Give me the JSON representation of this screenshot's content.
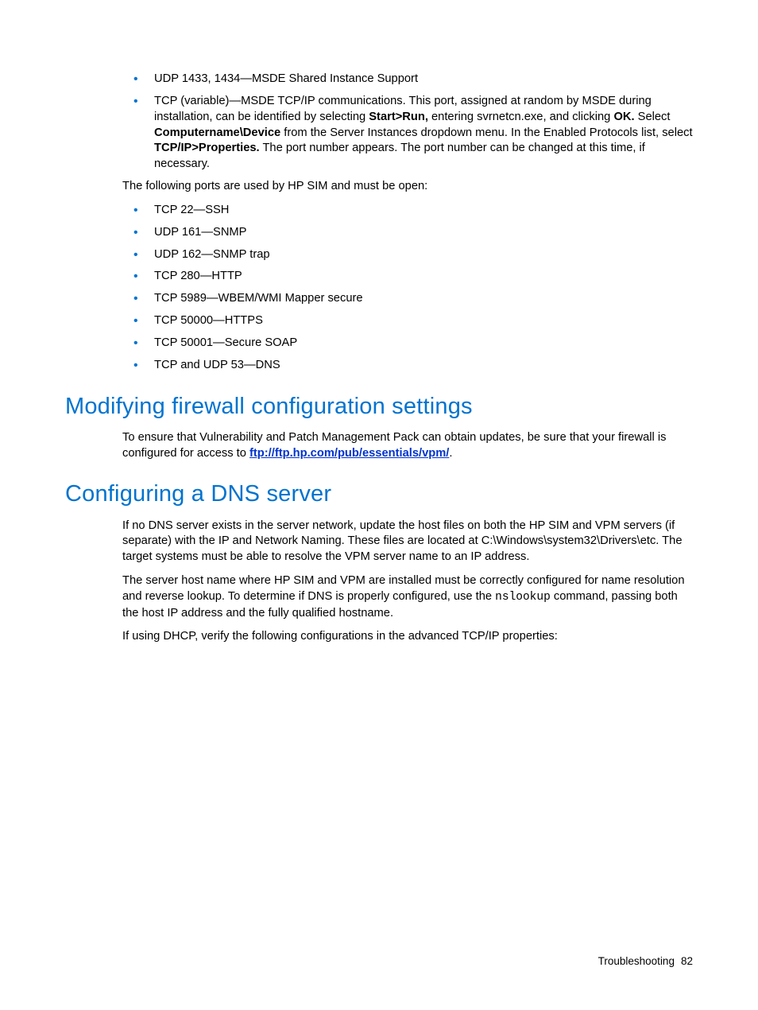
{
  "list1": {
    "item0": "UDP 1433, 1434—MSDE Shared Instance Support",
    "item1_pre": "TCP (variable)—MSDE TCP/IP communications. This port, assigned at random by MSDE during installation, can be identified by selecting ",
    "item1_b1": "Start>Run,",
    "item1_mid1": " entering svrnetcn.exe, and clicking ",
    "item1_b2": "OK.",
    "item1_mid2": " Select ",
    "item1_b3": "Computername\\Device",
    "item1_mid3": " from the Server Instances dropdown menu. In the Enabled Protocols list, select ",
    "item1_b4": "TCP/IP>Properties.",
    "item1_post": " The port number appears. The port number can be changed at this time, if necessary."
  },
  "intro2": "The following ports are used by HP SIM and must be open:",
  "list2": {
    "item0": "TCP 22—SSH",
    "item1": "UDP 161—SNMP",
    "item2": "UDP 162—SNMP trap",
    "item3": "TCP 280—HTTP",
    "item4": "TCP 5989—WBEM/WMI Mapper secure",
    "item5": "TCP 50000—HTTPS",
    "item6": "TCP 50001—Secure SOAP",
    "item7": "TCP and UDP 53—DNS"
  },
  "section1": {
    "heading": "Modifying firewall configuration settings",
    "para_pre": "To ensure that Vulnerability and Patch Management Pack can obtain updates, be sure that your firewall is configured for access to ",
    "link": "ftp://ftp.hp.com/pub/essentials/vpm/",
    "para_post": "."
  },
  "section2": {
    "heading": "Configuring a DNS server",
    "para1": "If no DNS server exists in the server network, update the host files on both the HP SIM and VPM servers (if separate) with the IP and Network Naming. These files are located at C:\\Windows\\system32\\Drivers\\etc. The target systems must be able to resolve the VPM server name to an IP address.",
    "para2_pre": "The server host name where HP SIM and VPM are installed must be correctly configured for name resolution and reverse lookup. To determine if DNS is properly configured, use the ",
    "para2_mono": "nslookup",
    "para2_post": " command, passing both the host IP address and the fully qualified hostname.",
    "para3": "If using DHCP, verify the following configurations in the advanced TCP/IP properties:"
  },
  "footer": {
    "section": "Troubleshooting",
    "page": "82"
  }
}
